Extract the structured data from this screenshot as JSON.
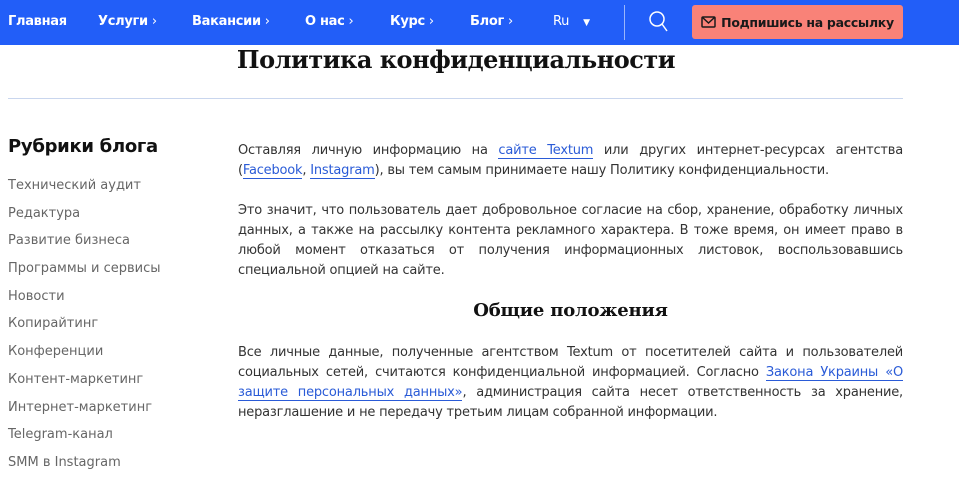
{
  "nav": {
    "items": [
      {
        "label": "Главная",
        "chevron": false
      },
      {
        "label": "Услуги",
        "chevron": true
      },
      {
        "label": "Вакансии",
        "chevron": true
      },
      {
        "label": "О нас",
        "chevron": true
      },
      {
        "label": "Курс",
        "chevron": true
      },
      {
        "label": "Блог",
        "chevron": true
      }
    ],
    "lang": "Ru",
    "subscribe": "Подпишись на рассылку",
    "color": "#225ef8",
    "button_color": "#f98278"
  },
  "page": {
    "title": "Политика конфиденциальности"
  },
  "sidebar": {
    "heading": "Рубрики блога",
    "items": [
      "Технический аудит",
      "Редактура",
      "Развитие бизнеса",
      "Программы и сервисы",
      "Новости",
      "Копирайтинг",
      "Конференции",
      "Контент-маркетинг",
      "Интернет-маркетинг",
      "Telegram-канал",
      "SMM в Instagram"
    ]
  },
  "content": {
    "p1": {
      "t1": "Оставляя личную информацию на ",
      "l1": "сайте Textum",
      "t2": " или других интернет-ресурсах агентства (",
      "l2": "Facebook",
      "t3": ", ",
      "l3": "Instagram",
      "t4": "), вы тем самым принимаете нашу Политику конфиденциальности."
    },
    "p2": "Это значит, что пользователь дает добровольное согласие на сбор, хранение, обработку личных данных, а также на рассылку контента рекламного характера. В тоже время, он имеет право в любой момент отказаться от получения информационных листовок, воспользовавшись специальной опцией на сайте.",
    "h2": "Общие положения",
    "p3": {
      "t1": "Все личные данные, полученные агентством Textum от посетителей сайта и пользователей социальных сетей, считаются конфиденциальной информацией. Согласно ",
      "l1": "Закона Украины «О защите персональных данных»",
      "t2": ", администрация сайта несет ответственность за хранение, неразглашение и не передачу третьим лицам собранной информации."
    }
  }
}
